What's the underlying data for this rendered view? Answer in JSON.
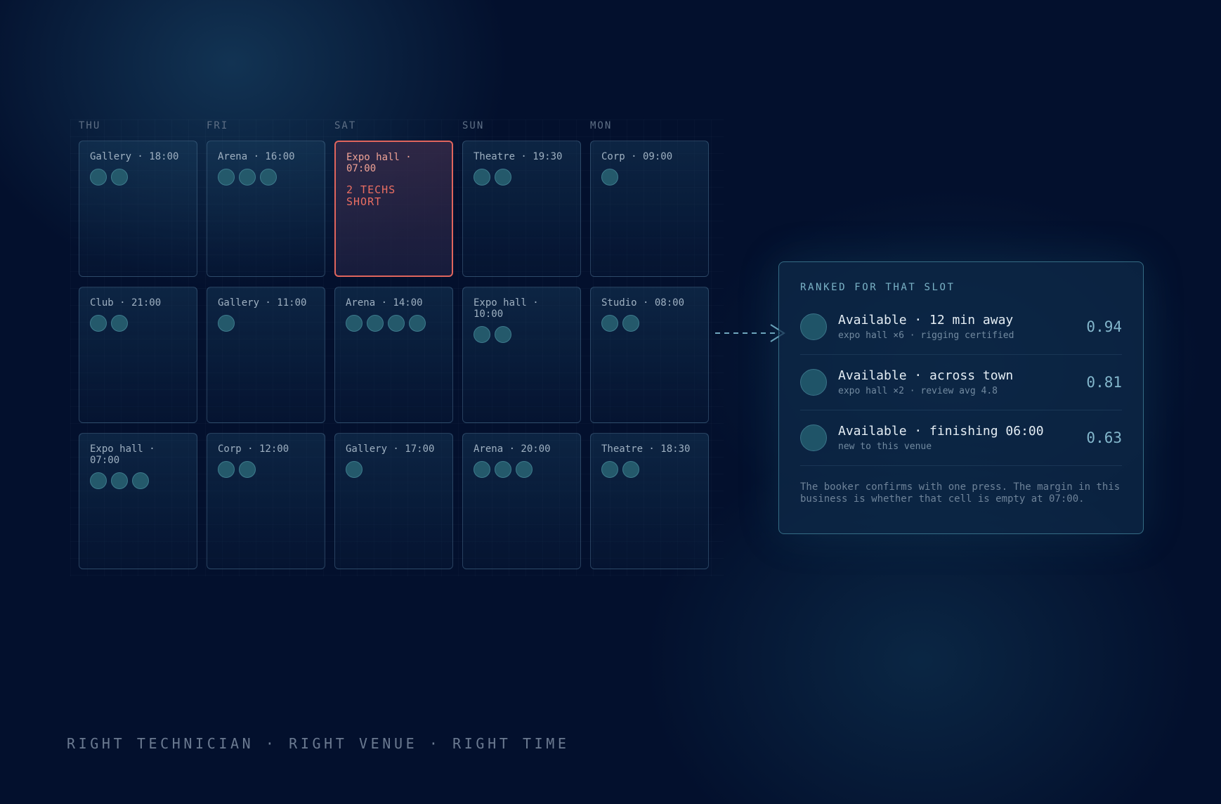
{
  "schedule": {
    "days": [
      "THU",
      "FRI",
      "SAT",
      "SUN",
      "MON"
    ],
    "rows": [
      [
        {
          "title": "Gallery · 18:00",
          "dots": 2
        },
        {
          "title": "Arena · 16:00",
          "dots": 3
        },
        {
          "title": "Expo hall ·\n07:00",
          "dots": 0,
          "alert": true,
          "warning": "2 TECHS\nSHORT"
        },
        {
          "title": "Theatre · 19:30",
          "dots": 2
        },
        {
          "title": "Corp · 09:00",
          "dots": 1
        }
      ],
      [
        {
          "title": "Club · 21:00",
          "dots": 2
        },
        {
          "title": "Gallery · 11:00",
          "dots": 1
        },
        {
          "title": "Arena · 14:00",
          "dots": 4
        },
        {
          "title": "Expo hall ·\n10:00",
          "dots": 2
        },
        {
          "title": "Studio · 08:00",
          "dots": 2
        }
      ],
      [
        {
          "title": "Expo hall ·\n07:00",
          "dots": 3
        },
        {
          "title": "Corp · 12:00",
          "dots": 2
        },
        {
          "title": "Gallery · 17:00",
          "dots": 1
        },
        {
          "title": "Arena · 20:00",
          "dots": 3
        },
        {
          "title": "Theatre · 18:30",
          "dots": 2
        }
      ]
    ]
  },
  "panel": {
    "heading": "RANKED FOR THAT SLOT",
    "candidates": [
      {
        "title": "Available · 12 min away",
        "detail": "expo hall ×6 · rigging certified",
        "score": "0.94"
      },
      {
        "title": "Available · across town",
        "detail": "expo hall ×2 · review avg 4.8",
        "score": "0.81"
      },
      {
        "title": "Available · finishing 06:00",
        "detail": "new to this venue",
        "score": "0.63"
      }
    ],
    "note": "The booker confirms with one press. The margin in this business is whether that cell is empty at 07:00."
  },
  "footer": {
    "tagline": "RIGHT TECHNICIAN · RIGHT VENUE · RIGHT TIME"
  },
  "colors": {
    "background": "#03102d",
    "alert": "#e0655d",
    "accent": "#7ab2c6"
  }
}
